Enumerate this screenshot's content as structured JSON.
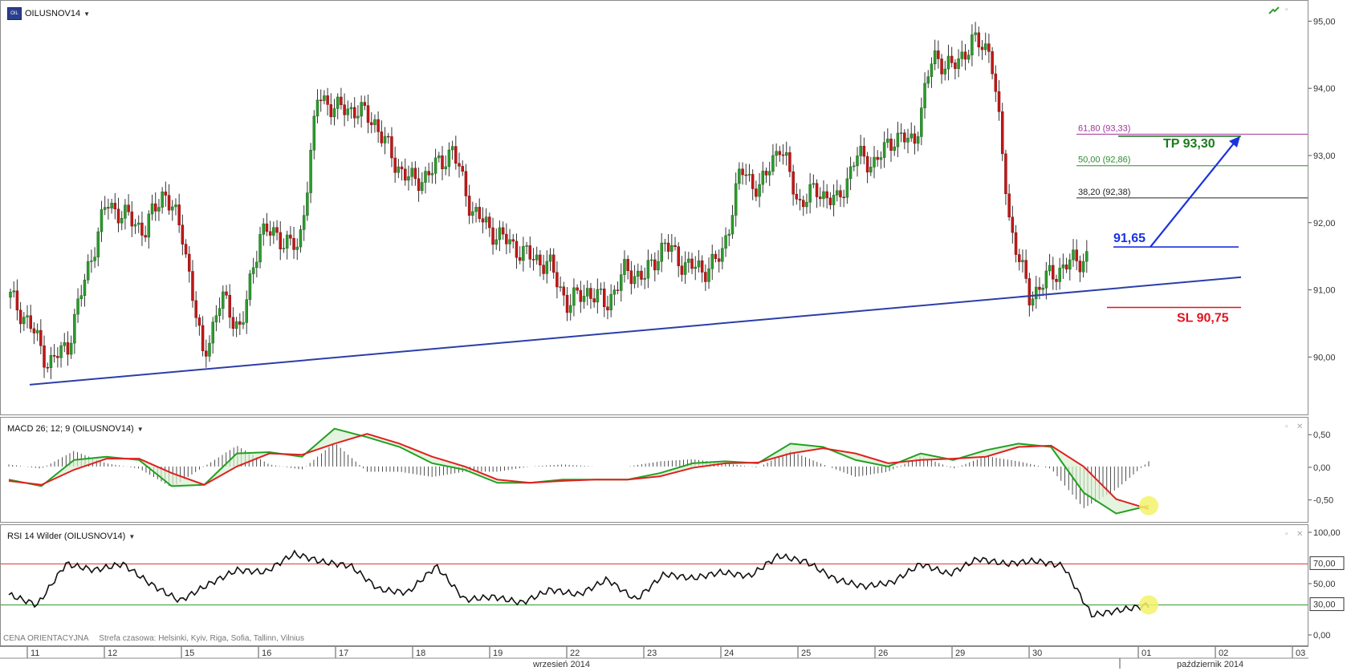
{
  "symbol": "OILUSNOV14",
  "price_panel": {
    "y_ticks": [
      "95,00",
      "94,00",
      "93,00",
      "92,00",
      "91,00",
      "90,00"
    ]
  },
  "macd_panel": {
    "title": "MACD 26; 12; 9 (OILUSNOV14)",
    "y_ticks": [
      "0,50",
      "0,00",
      "-0,50"
    ]
  },
  "rsi_panel": {
    "title": "RSI 14 Wilder (OILUSNOV14)",
    "y_ticks": [
      "100,00",
      "50,00",
      "0,00"
    ],
    "boxed_levels": [
      "70,00",
      "30,00"
    ]
  },
  "footer": {
    "price_type": "CENA ORIENTACYJNA",
    "timezone": "Strefa czasowa: Helsinki, Kyiv, Riga, Sofia, Tallinn, Vilnius"
  },
  "time_axis": {
    "days": [
      "11",
      "12",
      "15",
      "16",
      "17",
      "18",
      "19",
      "22",
      "23",
      "24",
      "25",
      "26",
      "29",
      "30",
      "01",
      "02",
      "03"
    ],
    "months": [
      "wrzesień 2014",
      "październik 2014"
    ]
  },
  "colors": {
    "trendline": "#2b3ea8",
    "fib618": "#a0339a",
    "fib50": "#2e8b2e",
    "fib382": "#222222",
    "entry": "#1a32e0",
    "tp": "#1a7a1a",
    "sl": "#e0141e",
    "macd": "#22a022",
    "signal": "#e02020",
    "rsi": "#111111",
    "highlight": "#f3f26a"
  },
  "chart_data": [
    {
      "type": "candlestick",
      "symbol": "OILUSNOV14",
      "ylim": [
        89.3,
        95.1
      ],
      "x_categories": [
        "11",
        "12",
        "15",
        "16",
        "17",
        "18",
        "19",
        "22",
        "23",
        "24",
        "25",
        "26",
        "29",
        "30",
        "01",
        "02",
        "03"
      ],
      "close_path": [
        90.9,
        90.5,
        89.9,
        90.2,
        91.3,
        92.3,
        92.1,
        91.9,
        92.5,
        91.8,
        90.0,
        90.9,
        90.4,
        91.9,
        91.8,
        91.6,
        93.9,
        93.7,
        93.7,
        93.5,
        92.9,
        92.6,
        92.8,
        93.1,
        92.2,
        91.9,
        91.7,
        91.5,
        91.4,
        90.8,
        91.0,
        90.8,
        91.3,
        91.2,
        91.7,
        91.4,
        91.3,
        91.5,
        92.8,
        92.5,
        93.2,
        92.3,
        92.5,
        92.3,
        93.0,
        92.9,
        93.3,
        93.2,
        94.5,
        94.3,
        94.7,
        94.6,
        92.0,
        90.9,
        91.2,
        91.4,
        91.5
      ],
      "fibonacci": [
        {
          "label": "61,80 (93,33)",
          "value": 93.33
        },
        {
          "label": "50,00 (92,86)",
          "value": 92.86
        },
        {
          "label": "38,20 (92,38)",
          "value": 92.38
        }
      ],
      "annotations": [
        {
          "label": "TP 93,30",
          "value": 93.3
        },
        {
          "label": "91,65",
          "value": 91.65
        },
        {
          "label": "SL 90,75",
          "value": 90.75
        }
      ],
      "trendline": {
        "from": [
          "11",
          89.6
        ],
        "to": [
          "02",
          91.2
        ]
      }
    },
    {
      "type": "line",
      "title": "MACD 26; 12; 9 (OILUSNOV14)",
      "ylim": [
        -0.75,
        0.65
      ],
      "series": [
        {
          "name": "MACD",
          "values": [
            -0.2,
            -0.3,
            0.1,
            0.15,
            0.1,
            -0.3,
            -0.28,
            0.2,
            0.22,
            0.15,
            0.58,
            0.45,
            0.3,
            0.05,
            -0.05,
            -0.25,
            -0.25,
            -0.2,
            -0.2,
            -0.2,
            -0.1,
            0.05,
            0.08,
            0.05,
            0.35,
            0.3,
            0.1,
            0.0,
            0.2,
            0.1,
            0.25,
            0.35,
            0.3,
            -0.4,
            -0.72,
            -0.6
          ]
        },
        {
          "name": "Signal",
          "values": [
            -0.22,
            -0.28,
            -0.05,
            0.12,
            0.12,
            -0.1,
            -0.28,
            0.0,
            0.2,
            0.18,
            0.35,
            0.5,
            0.35,
            0.15,
            0.0,
            -0.2,
            -0.25,
            -0.22,
            -0.2,
            -0.2,
            -0.15,
            -0.02,
            0.05,
            0.06,
            0.2,
            0.28,
            0.2,
            0.05,
            0.1,
            0.12,
            0.15,
            0.3,
            0.32,
            0.0,
            -0.5,
            -0.65
          ]
        }
      ]
    },
    {
      "type": "line",
      "title": "RSI 14 Wilder (OILUSNOV14)",
      "ylim": [
        0,
        100
      ],
      "levels": [
        70,
        30
      ],
      "series": [
        {
          "name": "RSI",
          "values": [
            40,
            30,
            70,
            64,
            70,
            50,
            34,
            50,
            64,
            62,
            80,
            72,
            68,
            45,
            42,
            68,
            35,
            38,
            32,
            45,
            40,
            55,
            35,
            60,
            56,
            62,
            58,
            78,
            72,
            55,
            48,
            52,
            70,
            60,
            75,
            70,
            73,
            68,
            20,
            25,
            30
          ]
        }
      ]
    }
  ]
}
